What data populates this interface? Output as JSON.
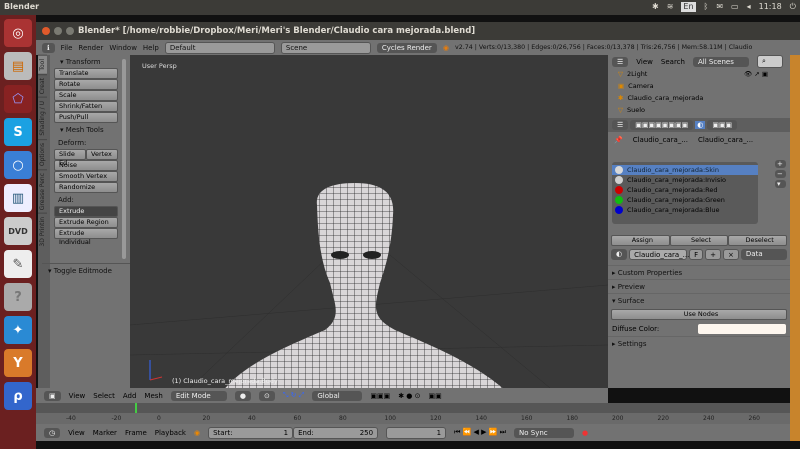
{
  "topbar": {
    "app": "Blender",
    "keyboard": "En",
    "time": "11:18"
  },
  "window": {
    "title": "Blender* [/home/robbie/Dropbox/Meri/Meri's Blender/Claudio  cara mejorada.blend]"
  },
  "header": {
    "menus": [
      "File",
      "Render",
      "Window",
      "Help"
    ],
    "layout": "Default",
    "scene": "Scene",
    "engine": "Cycles Render",
    "stats": "v2.74 | Verts:0/13,380 | Edges:0/26,756 | Faces:0/13,378 | Tris:26,756 | Mem:58.11M | Claudio"
  },
  "tools": {
    "tabs": [
      "Tool",
      "Creat",
      "Shading / U",
      "Options",
      "Grease Penc",
      "3D Printin"
    ],
    "transform_title": "Transform",
    "transform": [
      "Translate",
      "Rotate",
      "Scale",
      "Shrink/Fatten",
      "Push/Pull"
    ],
    "mesh_title": "Mesh Tools",
    "deform_label": "Deform:",
    "slide": "Slide Ed",
    "vertex": "Vertex",
    "deform": [
      "Noise",
      "Smooth Vertex",
      "Randomize"
    ],
    "add_label": "Add:",
    "extrude": "Extrude",
    "add": [
      "Extrude Region",
      "Extrude Individual"
    ],
    "toggle": "Toggle Editmode"
  },
  "viewport": {
    "label": "User Persp",
    "object_info": "(1) Claudio_cara_mejorada.Body"
  },
  "outliner": {
    "view": "View",
    "search": "Search",
    "filter": "All Scenes",
    "items": [
      "2Light",
      "Camera",
      "Claudio_cara_mejorada",
      "Suelo"
    ]
  },
  "properties": {
    "breadcrumb": [
      "Claudio_cara_...",
      "Claudio_cara_..."
    ],
    "slots": [
      {
        "name": "Claudio_cara_mejorada:Skin",
        "color": "#d8d8d8"
      },
      {
        "name": "Claudio_cara_mejorada:Invisio",
        "color": "#cfcfcf"
      },
      {
        "name": "Claudio_cara_mejorada:Red",
        "color": "#cc0000"
      },
      {
        "name": "Claudio_cara_mejorada:Green",
        "color": "#11bb11"
      },
      {
        "name": "Claudio_cara_mejorada:Blue",
        "color": "#0000cc"
      }
    ],
    "assign": "Assign",
    "select": "Select",
    "deselect": "Deselect",
    "material": "Claudio_cara_...",
    "f": "F",
    "link": "Data",
    "panels": {
      "custom": "Custom Properties",
      "preview": "Preview",
      "surface": "Surface",
      "use_nodes": "Use Nodes",
      "diffuse": "Diffuse Color:",
      "settings": "Settings"
    },
    "diffuse_color": "#fdf6ee"
  },
  "view3d_header": {
    "menus": [
      "View",
      "Select",
      "Add",
      "Mesh"
    ],
    "mode": "Edit Mode",
    "orientation": "Global"
  },
  "ruler": [
    "-40",
    "-20",
    "0",
    "20",
    "40",
    "60",
    "80",
    "100",
    "120",
    "140",
    "160",
    "180",
    "200",
    "220",
    "240",
    "260"
  ],
  "timeline": {
    "menus": [
      "View",
      "Marker",
      "Frame",
      "Playback"
    ],
    "start_label": "Start:",
    "start": "1",
    "end_label": "End:",
    "end": "250",
    "current": "1",
    "sync": "No Sync"
  }
}
